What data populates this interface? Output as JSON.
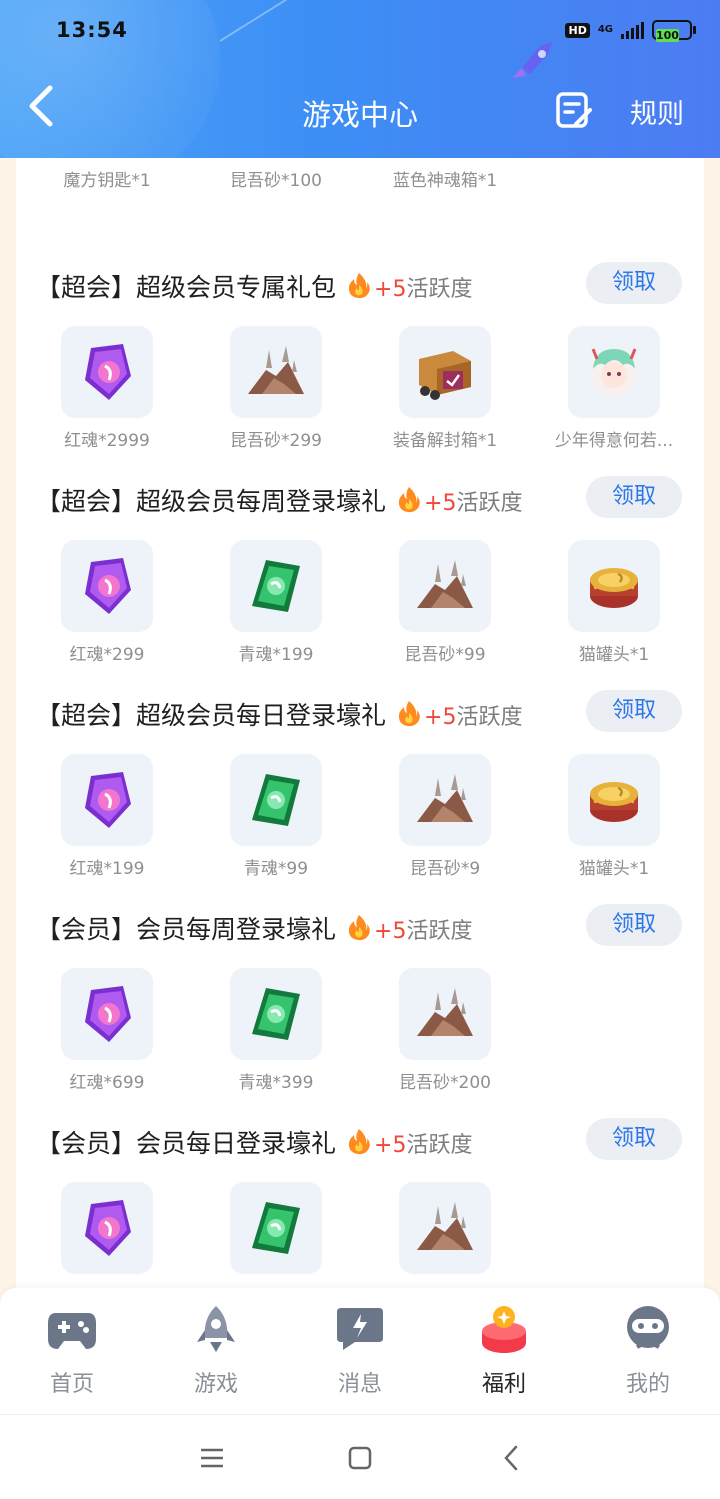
{
  "status_bar": {
    "time": "13:54",
    "hd": "HD",
    "network": "4G",
    "battery": "100"
  },
  "header": {
    "title": "游戏中心",
    "rules_label": "规则"
  },
  "top_partial_items": [
    {
      "name": "魔方钥匙*1",
      "icon": "key-icon"
    },
    {
      "name": "昆吾砂*100",
      "icon": "sand-icon"
    },
    {
      "name": "蓝色神魂箱*1",
      "icon": "box-icon"
    }
  ],
  "packs": [
    {
      "title": "【超会】超级会员专属礼包",
      "plus": "+5",
      "activity": "活跃度",
      "claim": "领取",
      "items": [
        {
          "name": "红魂*2999",
          "icon": "red-soul-icon"
        },
        {
          "name": "昆吾砂*299",
          "icon": "sand-icon"
        },
        {
          "name": "装备解封箱*1",
          "icon": "equipment-box-icon"
        },
        {
          "name": "少年得意何若...",
          "icon": "avatar-frame-icon"
        }
      ]
    },
    {
      "title": "【超会】超级会员每周登录壕礼",
      "plus": "+5",
      "activity": "活跃度",
      "claim": "领取",
      "items": [
        {
          "name": "红魂*299",
          "icon": "red-soul-icon"
        },
        {
          "name": "青魂*199",
          "icon": "green-soul-icon"
        },
        {
          "name": "昆吾砂*99",
          "icon": "sand-icon"
        },
        {
          "name": "猫罐头*1",
          "icon": "cat-can-icon"
        }
      ]
    },
    {
      "title": "【超会】超级会员每日登录壕礼",
      "plus": "+5",
      "activity": "活跃度",
      "claim": "领取",
      "items": [
        {
          "name": "红魂*199",
          "icon": "red-soul-icon"
        },
        {
          "name": "青魂*99",
          "icon": "green-soul-icon"
        },
        {
          "name": "昆吾砂*9",
          "icon": "sand-icon"
        },
        {
          "name": "猫罐头*1",
          "icon": "cat-can-icon"
        }
      ]
    },
    {
      "title": "【会员】会员每周登录壕礼",
      "plus": "+5",
      "activity": "活跃度",
      "claim": "领取",
      "items": [
        {
          "name": "红魂*699",
          "icon": "red-soul-icon"
        },
        {
          "name": "青魂*399",
          "icon": "green-soul-icon"
        },
        {
          "name": "昆吾砂*200",
          "icon": "sand-icon"
        }
      ]
    },
    {
      "title": "【会员】会员每日登录壕礼",
      "plus": "+5",
      "activity": "活跃度",
      "claim": "领取",
      "items": [
        {
          "name": "",
          "icon": "red-soul-icon"
        },
        {
          "name": "",
          "icon": "green-soul-icon"
        },
        {
          "name": "",
          "icon": "sand-icon"
        }
      ]
    }
  ],
  "tabs": [
    {
      "label": "首页",
      "icon": "gamepad-icon"
    },
    {
      "label": "游戏",
      "icon": "rocket-icon"
    },
    {
      "label": "消息",
      "icon": "message-icon"
    },
    {
      "label": "福利",
      "icon": "gift-icon",
      "active": true
    },
    {
      "label": "我的",
      "icon": "robot-avatar-icon"
    }
  ],
  "colors": {
    "header": "#4a8ff5",
    "accent": "#2e77ea",
    "plus": "#f0473a"
  }
}
